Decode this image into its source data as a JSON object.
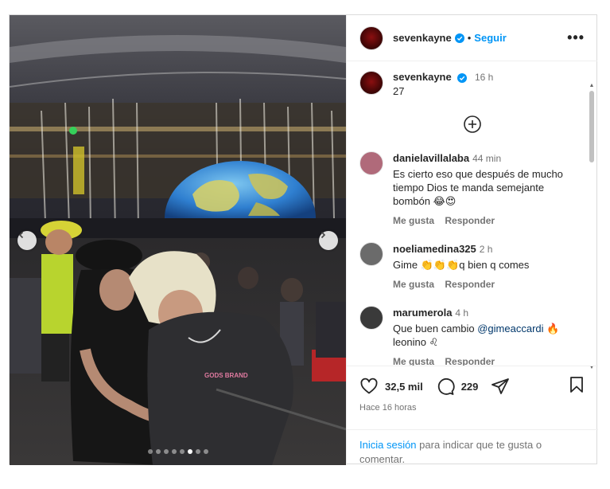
{
  "post": {
    "author": "sevenkayne",
    "follow_label": "Seguir",
    "separator": "•",
    "more_label": "•••"
  },
  "caption": {
    "username": "sevenkayne",
    "time": "16 h",
    "text": "27"
  },
  "carousel": {
    "total_slides": 8,
    "active_slide": 6,
    "shirt_text": "GODS BRAND"
  },
  "comments": [
    {
      "username": "danielavillalaba",
      "time": "44 min",
      "text": "Es cierto eso que después de mucho tiempo Dios te manda semejante bombón 😂😍",
      "like_label": "Me gusta",
      "reply_label": "Responder",
      "avatar_color": "#b06a7a"
    },
    {
      "username": "noeliamedina325",
      "time": "2 h",
      "text": "Gime 👏👏👏q bien q comes",
      "like_label": "Me gusta",
      "reply_label": "Responder",
      "avatar_color": "#6b6b6b"
    },
    {
      "username": "marumerola",
      "time": "4 h",
      "text_before": "Que buen cambio ",
      "mention": "@gimeaccardi",
      "text_after": " 🔥 leonino ♌",
      "like_label": "Me gusta",
      "reply_label": "Responder",
      "avatar_color": "#3a3a3a"
    }
  ],
  "actions": {
    "likes": "32,5 mil",
    "comments": "229",
    "posted_ago": "Hace 16 horas"
  },
  "login_prompt": {
    "link": "Inicia sesión",
    "text": " para indicar que te gusta o comentar."
  },
  "colors": {
    "accent": "#0095f6",
    "verified": "#0095f6",
    "secondary_text": "#737373"
  },
  "icons": [
    "chevron-left-icon",
    "chevron-right-icon",
    "verified-badge-icon",
    "more-options-icon",
    "add-circle-icon",
    "heart-icon",
    "comment-icon",
    "share-icon",
    "bookmark-icon"
  ]
}
